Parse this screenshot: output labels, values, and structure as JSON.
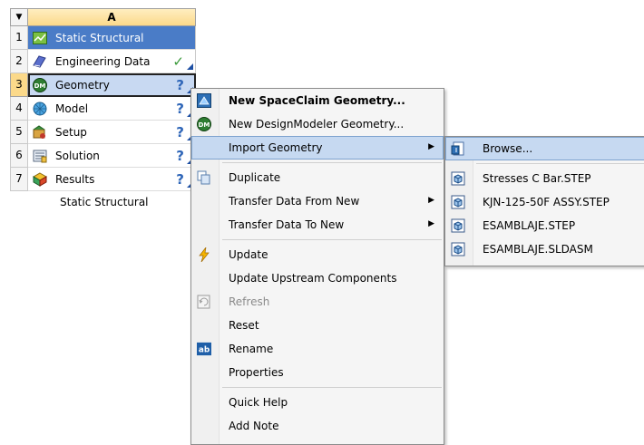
{
  "system": {
    "column_header": "A",
    "rows": [
      {
        "num": "1",
        "label": "Static Structural",
        "icon": "static-structural-icon"
      },
      {
        "num": "2",
        "label": "Engineering Data",
        "icon": "engineering-data-icon",
        "status": "✓"
      },
      {
        "num": "3",
        "label": "Geometry",
        "icon": "designmodeler-icon",
        "status": "?"
      },
      {
        "num": "4",
        "label": "Model",
        "icon": "model-icon",
        "status": "?"
      },
      {
        "num": "5",
        "label": "Setup",
        "icon": "setup-icon",
        "status": "?"
      },
      {
        "num": "6",
        "label": "Solution",
        "icon": "solution-icon",
        "status": "?"
      },
      {
        "num": "7",
        "label": "Results",
        "icon": "results-icon",
        "status": "?"
      }
    ],
    "caption": "Static Structural"
  },
  "context_menu": {
    "items": {
      "new_spaceclaim": "New SpaceClaim Geometry...",
      "new_designmodeler": "New DesignModeler Geometry...",
      "import_geometry": "Import Geometry",
      "duplicate": "Duplicate",
      "transfer_from_new": "Transfer Data From New",
      "transfer_to_new": "Transfer Data To New",
      "update": "Update",
      "update_upstream": "Update Upstream Components",
      "refresh": "Refresh",
      "reset": "Reset",
      "rename": "Rename",
      "properties": "Properties",
      "quick_help": "Quick Help",
      "add_note": "Add Note"
    },
    "submenu_arrow": "▶"
  },
  "import_submenu": {
    "items": {
      "browse": "Browse...",
      "file1": "Stresses C Bar.STEP",
      "file2": "KJN-125-50F ASSY.STEP",
      "file3": "ESAMBLAJE.STEP",
      "file4": "ESAMBLAJE.SLDASM"
    }
  },
  "colors": {
    "title_cell": "#4a7cc7",
    "selected_cell": "#c8d9f2",
    "menu_highlight": "#c6d9f1",
    "status_question": "#2f66b8",
    "status_check": "#3a9a3a"
  }
}
